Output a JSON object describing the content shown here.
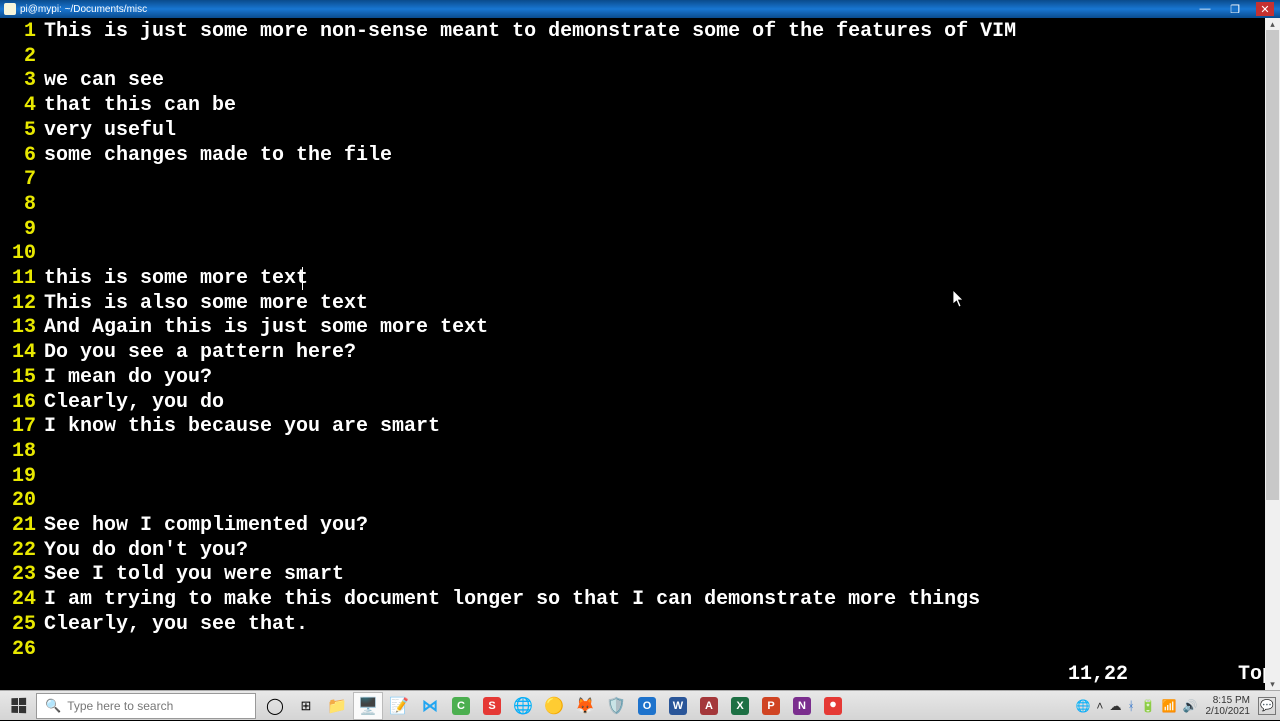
{
  "window": {
    "title": "pi@mypi: ~/Documents/misc"
  },
  "editor": {
    "lines": [
      {
        "n": 1,
        "t": "This is just some more non-sense meant to demonstrate some of the features of VIM"
      },
      {
        "n": 2,
        "t": ""
      },
      {
        "n": 3,
        "t": "we can see"
      },
      {
        "n": 4,
        "t": "that this can be"
      },
      {
        "n": 5,
        "t": "very useful"
      },
      {
        "n": 6,
        "t": "some changes made to the file"
      },
      {
        "n": 7,
        "t": ""
      },
      {
        "n": 8,
        "t": ""
      },
      {
        "n": 9,
        "t": ""
      },
      {
        "n": 10,
        "t": ""
      },
      {
        "n": 11,
        "t": "this is some more text"
      },
      {
        "n": 12,
        "t": "This is also some more text"
      },
      {
        "n": 13,
        "t": "And Again this is just some more text"
      },
      {
        "n": 14,
        "t": "Do you see a pattern here?"
      },
      {
        "n": 15,
        "t": "I mean do you?"
      },
      {
        "n": 16,
        "t": "Clearly, you do"
      },
      {
        "n": 17,
        "t": "I know this because you are smart"
      },
      {
        "n": 18,
        "t": ""
      },
      {
        "n": 19,
        "t": ""
      },
      {
        "n": 20,
        "t": ""
      },
      {
        "n": 21,
        "t": "See how I complimented you?"
      },
      {
        "n": 22,
        "t": "You do don't you?"
      },
      {
        "n": 23,
        "t": "See I told you were smart"
      },
      {
        "n": 24,
        "t": "I am trying to make this document longer so that I can demonstrate more things"
      },
      {
        "n": 25,
        "t": "Clearly, you see that."
      },
      {
        "n": 26,
        "t": ""
      }
    ],
    "cursor": {
      "line": 11,
      "col": 22
    }
  },
  "status": {
    "position": "11,22",
    "scroll": "Top"
  },
  "taskbar": {
    "search_placeholder": "Type here to search",
    "clock_time": "8:15 PM",
    "clock_date": "2/10/2021"
  }
}
